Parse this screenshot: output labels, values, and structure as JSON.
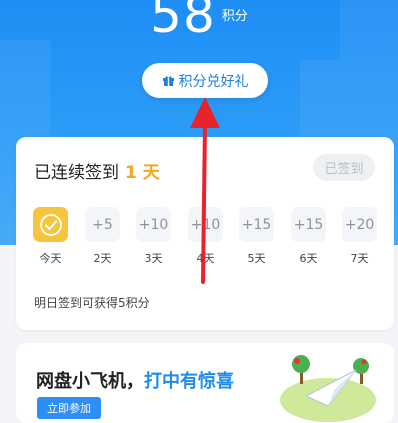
{
  "header": {
    "points_value": "58",
    "points_unit": "积分",
    "redeem_label": "积分兑好礼"
  },
  "signin_card": {
    "title_prefix": "已连续签到",
    "streak_days": "1 天",
    "signed_label": "已签到",
    "days": [
      {
        "value": "",
        "label": "今天",
        "checked": true
      },
      {
        "value": "+5",
        "label": "2天"
      },
      {
        "value": "+10",
        "label": "3天"
      },
      {
        "value": "+10",
        "label": "4天"
      },
      {
        "value": "+15",
        "label": "5天"
      },
      {
        "value": "+15",
        "label": "6天"
      },
      {
        "value": "+20",
        "label": "7天"
      }
    ],
    "tomorrow_tip": "明日签到可获得5积分"
  },
  "promo": {
    "title_main": "网盘小飞机，",
    "title_highlight": "打中有惊喜",
    "join_label": "立即参加"
  },
  "colors": {
    "hero_blue": "#1f8ef5",
    "accent_orange": "#f5a623",
    "arrow_red": "#e8232b",
    "checked_yellow": "#f6c53e"
  }
}
